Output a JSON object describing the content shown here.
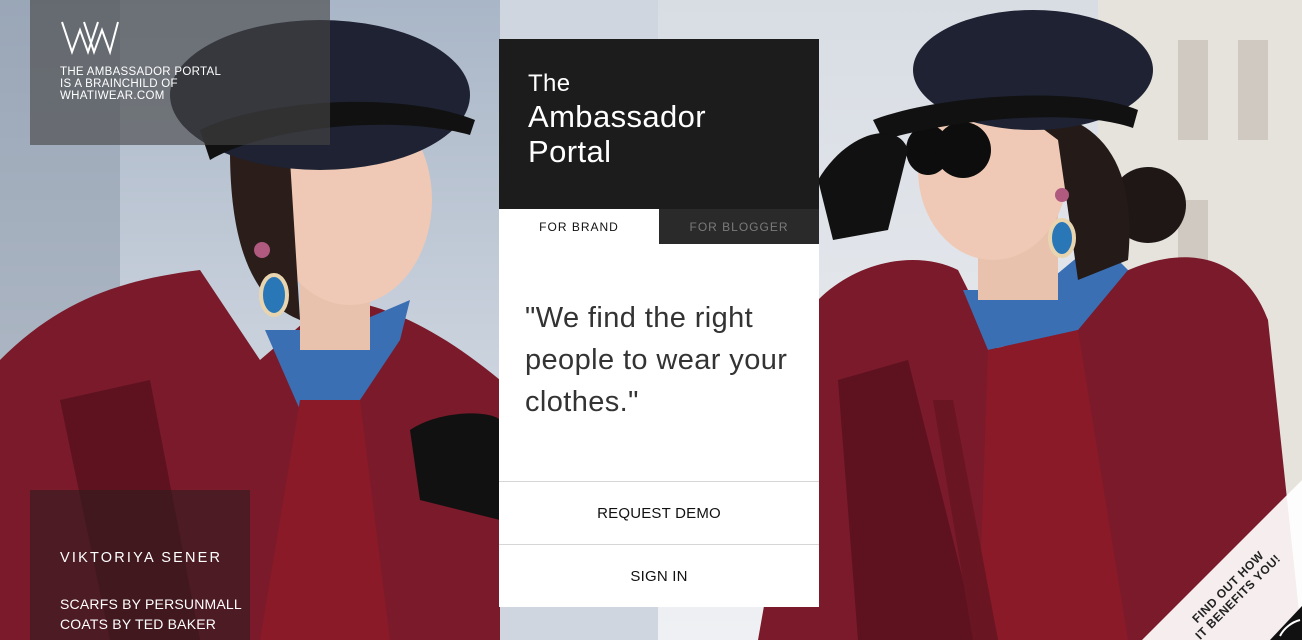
{
  "brand": {
    "logo_text": "WW",
    "tagline": [
      "THE AMBASSADOR PORTAL",
      "IS A BRAINCHILD OF",
      "WHATIWEAR.COM"
    ]
  },
  "credits": {
    "name": "VIKTORIYA SENER",
    "lines": [
      "SCARFS BY PERSUNMALL",
      "COATS BY TED BAKER"
    ]
  },
  "card": {
    "title_small": "The",
    "title_lines": [
      "Ambassador",
      "Portal"
    ],
    "tabs": [
      {
        "label": "FOR BRAND",
        "active": true
      },
      {
        "label": "FOR BLOGGER",
        "active": false
      }
    ],
    "quote": "\"We find the right people to wear your clothes.\"",
    "request_demo_label": "REQUEST DEMO",
    "sign_in_label": "SIGN IN"
  },
  "corner": {
    "lines": [
      "FIND OUT HOW",
      "IT BENEFITS YOU!"
    ]
  },
  "colors": {
    "card_header": "#1c1c1c",
    "coat": "#7a1a2a",
    "denim": "#3b6fb4"
  }
}
